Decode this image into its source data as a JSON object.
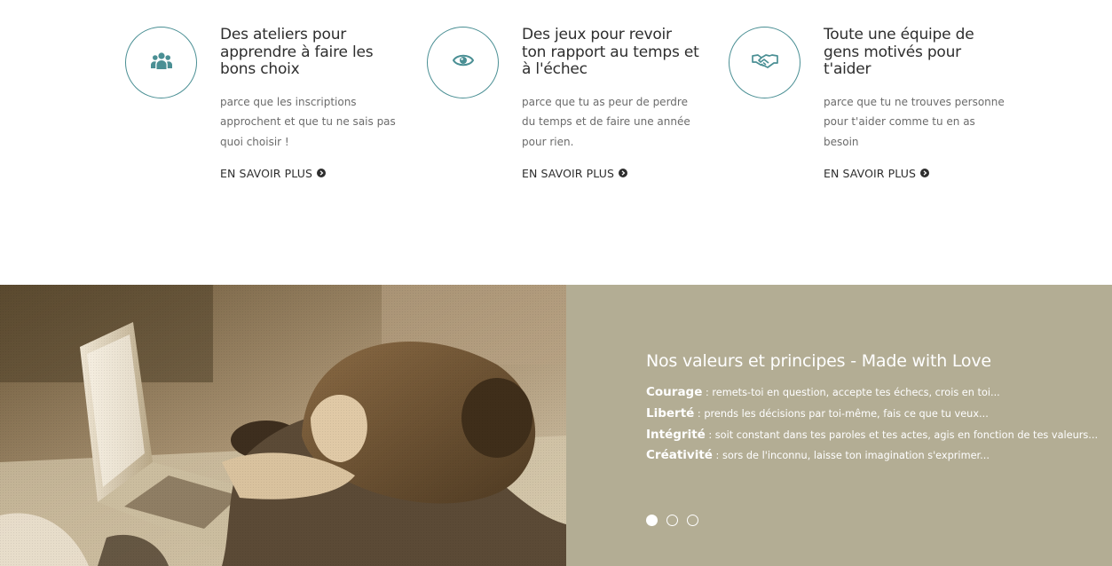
{
  "features": [
    {
      "icon": "users-icon",
      "title": "Des ateliers pour apprendre à faire les bons choix",
      "text": "parce que les inscriptions approchent et que tu ne sais pas quoi choisir !",
      "link": "EN SAVOIR PLUS"
    },
    {
      "icon": "eye-icon",
      "title": "Des jeux pour revoir ton rapport au temps et à l'échec",
      "text": "parce que tu as peur de perdre du temps et de faire une année pour rien.",
      "link": "EN SAVOIR PLUS"
    },
    {
      "icon": "handshake-icon",
      "title": "Toute une équipe de gens motivés pour t'aider",
      "text": "parce que tu ne trouves personne pour t'aider comme tu en as besoin",
      "link": "EN SAVOIR PLUS"
    }
  ],
  "values": {
    "title": "Nos valeurs et principes - Made with Love",
    "items": [
      {
        "name": "Courage",
        "text": " : remets-toi en question, accepte tes échecs, crois en toi..."
      },
      {
        "name": "Liberté",
        "text": " : prends les décisions par toi-même, fais ce que tu veux..."
      },
      {
        "name": "Intégrité",
        "text": " : soit constant dans tes paroles et tes actes, agis en fonction de tes valeurs..."
      },
      {
        "name": "Créativité",
        "text": " : sors de l'inconnu, laisse ton imagination s'exprimer..."
      }
    ],
    "carousel_slides": 3,
    "active_slide": 1
  },
  "colors": {
    "accent": "#4a8f94",
    "panel_bg": "#b3ad94",
    "photo_tone": "#7f6a4c"
  }
}
